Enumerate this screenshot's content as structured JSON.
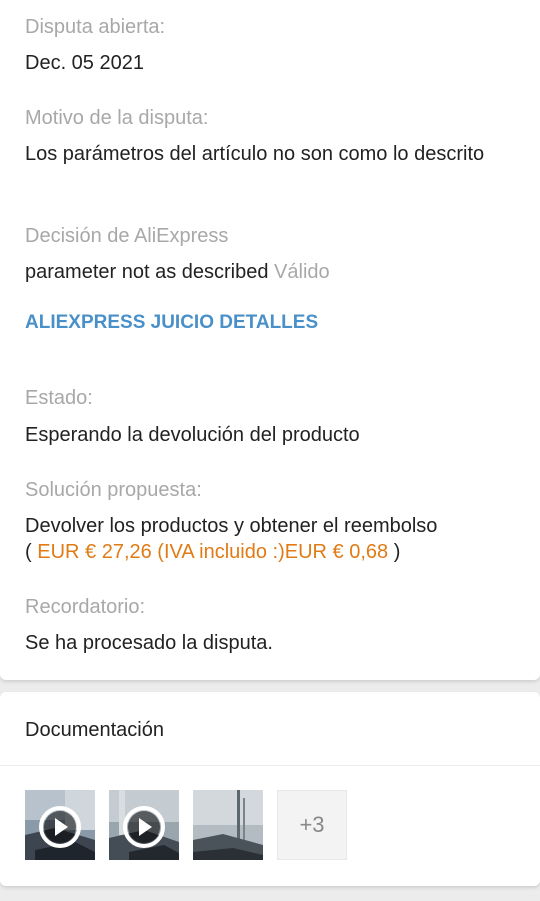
{
  "dispute": {
    "opened_label": "Disputa abierta:",
    "opened_value": "Dec. 05 2021",
    "reason_label": "Motivo de la disputa:",
    "reason_value": "Los parámetros del artículo no son como lo descrito",
    "decision_label": "Decisión de AliExpress",
    "decision_value": "parameter not as described",
    "decision_status": "Válido",
    "judgment_link": "ALIEXPRESS JUICIO DETALLES",
    "status_label": "Estado:",
    "status_value": "Esperando la devolución del producto",
    "solution_label": "Solución propuesta:",
    "solution_value": "Devolver los productos y obtener el reembolso",
    "solution_open": "(",
    "solution_amount": "EUR € 27,26 (IVA incluido :)EUR € 0,68",
    "solution_close": ")",
    "reminder_label": "Recordatorio:",
    "reminder_value": "Se ha procesado la disputa."
  },
  "documentation": {
    "title": "Documentación",
    "thumbnails": [
      {
        "kind": "video",
        "icon": "play-icon"
      },
      {
        "kind": "video",
        "icon": "play-icon"
      },
      {
        "kind": "image"
      }
    ],
    "more_label": "+3"
  },
  "colors": {
    "label_gray": "#a8a8a8",
    "link_blue": "#4a90c8",
    "amount_orange": "#e07b16"
  }
}
